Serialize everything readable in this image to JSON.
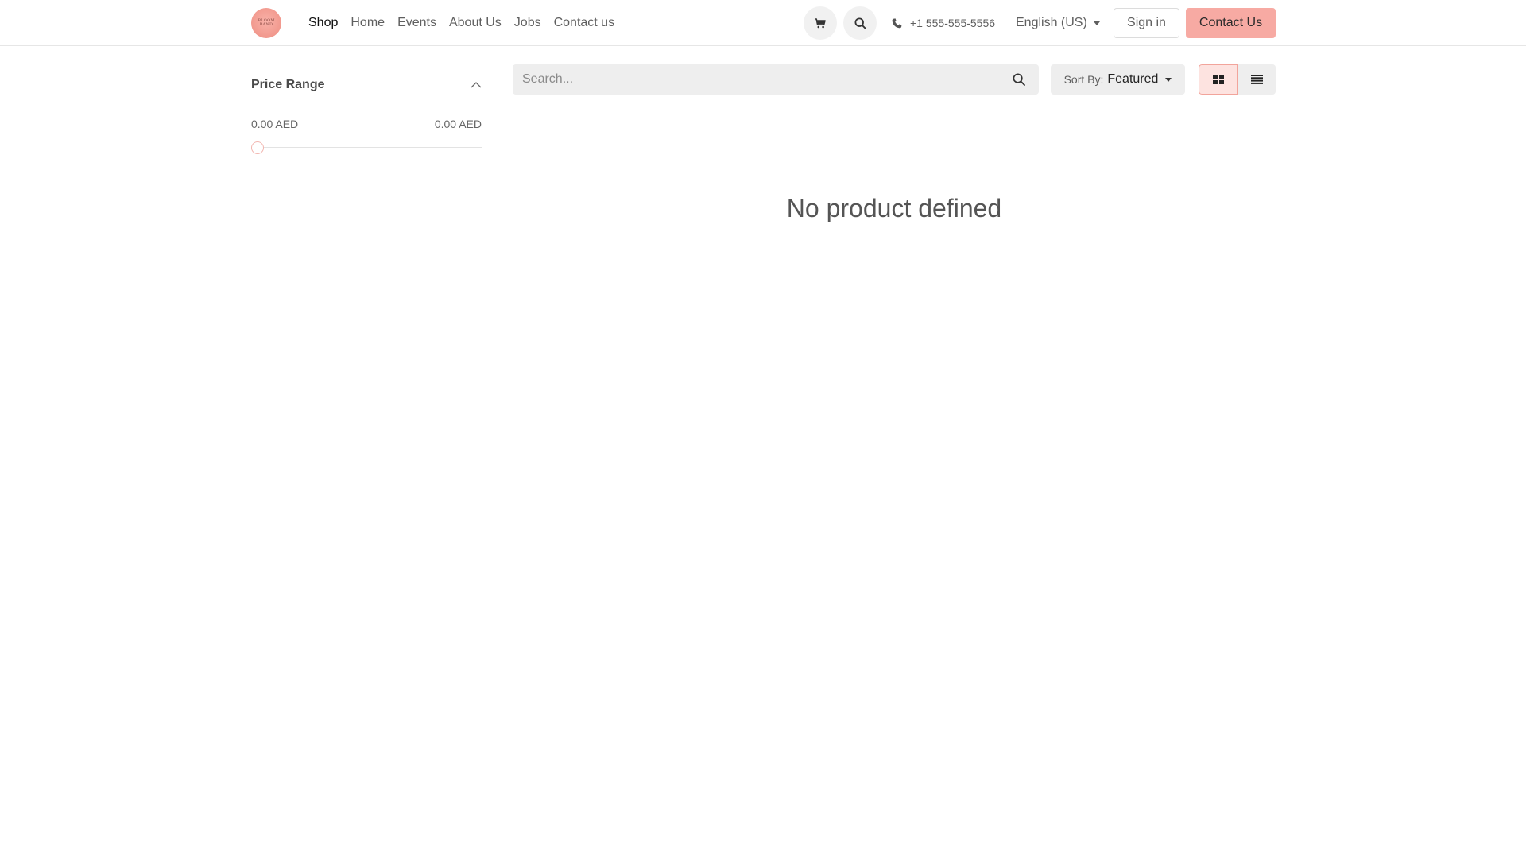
{
  "header": {
    "logo_text_line1": "BLOOM",
    "logo_text_line2": "BAND",
    "nav": [
      {
        "label": "Shop",
        "active": true
      },
      {
        "label": "Home"
      },
      {
        "label": "Events"
      },
      {
        "label": "About Us"
      },
      {
        "label": "Jobs"
      },
      {
        "label": "Contact us"
      }
    ],
    "phone": "+1 555-555-5556",
    "language": "English (US)",
    "sign_in": "Sign in",
    "contact_button": "Contact Us"
  },
  "sidebar": {
    "price_range": {
      "title": "Price Range",
      "min_label": "0.00 AED",
      "max_label": "0.00 AED"
    }
  },
  "toolbar": {
    "search_placeholder": "Search...",
    "sort_label": "Sort By:",
    "sort_value": "Featured"
  },
  "main": {
    "empty_message": "No product defined"
  },
  "colors": {
    "accent": "#f7aaa3",
    "accent_border": "#f2a49b",
    "toolbar_bg": "#eeeeee"
  }
}
